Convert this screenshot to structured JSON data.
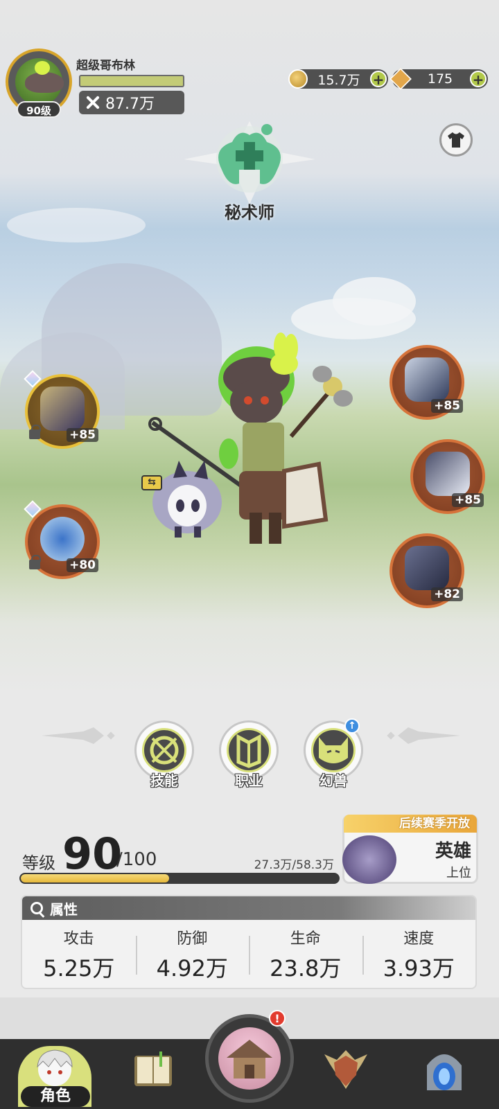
{
  "player": {
    "name": "超级哥布林",
    "level_tag": "90级",
    "power": "87.7万"
  },
  "currencies": {
    "gold": "15.7万",
    "gems": "175",
    "plus": "+"
  },
  "class": {
    "name": "秘术师"
  },
  "equipment": {
    "left": [
      {
        "level": "+85",
        "locked": true
      },
      {
        "level": "+80",
        "locked": true
      }
    ],
    "right": [
      {
        "level": "+85"
      },
      {
        "level": "+85"
      },
      {
        "level": "+82"
      }
    ]
  },
  "menu": {
    "skills": "技能",
    "profession": "职业",
    "beast": "幻兽"
  },
  "level": {
    "label": "等级",
    "current": "90",
    "max": "/100",
    "exp": "27.3万/58.3万",
    "exp_fraction": 0.468
  },
  "rank": {
    "banner": "后续赛季开放",
    "title": "英雄",
    "sub": "上位"
  },
  "attributes": {
    "header": "属性",
    "items": [
      {
        "name": "攻击",
        "value": "5.25万"
      },
      {
        "name": "防御",
        "value": "4.92万"
      },
      {
        "name": "生命",
        "value": "23.8万"
      },
      {
        "name": "速度",
        "value": "3.93万"
      }
    ]
  },
  "nav": {
    "character": "角色"
  },
  "colors": {
    "accent": "#d9e07d",
    "exp_fill": "#e7b93c",
    "slot_border": "#d6733a",
    "alert": "#e23b2e"
  },
  "icons": {
    "alert": "!",
    "upgrade": "↑",
    "swap": "⇆",
    "shirt": "👕"
  }
}
